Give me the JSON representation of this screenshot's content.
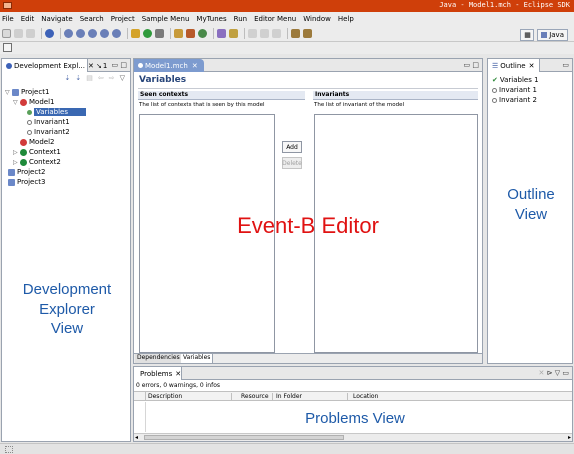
{
  "window": {
    "title": "Java - Model1.mch - Eclipse SDK"
  },
  "menu": [
    "File",
    "Edit",
    "Navigate",
    "Search",
    "Project",
    "Sample Menu",
    "MyTunes",
    "Run",
    "Editor Menu",
    "Window",
    "Help"
  ],
  "perspective": {
    "label": "Java"
  },
  "explorer": {
    "tab_label": "Development Expl...",
    "tab2_label": "1",
    "tree": [
      {
        "label": "Project1",
        "icon": "project",
        "depth": 0,
        "expanded": true
      },
      {
        "label": "Model1",
        "icon": "model",
        "depth": 1,
        "expanded": true
      },
      {
        "label": "Variables",
        "icon": "variable",
        "depth": 2,
        "selected": true
      },
      {
        "label": "Invariant1",
        "icon": "invariant",
        "depth": 2
      },
      {
        "label": "Invariant2",
        "icon": "invariant",
        "depth": 2
      },
      {
        "label": "Model2",
        "icon": "model",
        "depth": 1
      },
      {
        "label": "Context1",
        "icon": "context",
        "depth": 1,
        "collapsed": true
      },
      {
        "label": "Context2",
        "icon": "context",
        "depth": 1,
        "collapsed": true
      },
      {
        "label": "Project2",
        "icon": "project",
        "depth": 0
      },
      {
        "label": "Project3",
        "icon": "project",
        "depth": 0
      }
    ]
  },
  "editor": {
    "tab_label": "Model1.mch",
    "title": "Variables",
    "seen_header": "Seen contexts",
    "seen_desc": "The list of contexts that is seen by this model",
    "add_label": "Add",
    "delete_label": "Delete",
    "invariants_header": "Invariants",
    "invariants_desc": "The list of invariant of the model",
    "bottom_tabs": [
      "Dependencies",
      "Variables"
    ]
  },
  "outline": {
    "tab_label": "Outline",
    "items": [
      "Variables 1",
      "Invariant 1",
      "Invariant 2"
    ]
  },
  "problems": {
    "tab_label": "Problems",
    "summary": "0 errors, 0 warnings, 0 infos",
    "columns": [
      "Description",
      "Resource",
      "In Folder",
      "Location"
    ]
  },
  "overlays": {
    "editor": "Event-B Editor",
    "explorer": "Development\nExplorer\nView",
    "outline": "Outline\nView",
    "problems": "Problems View"
  },
  "colors": {
    "titlebar": "#cf3f0a",
    "overlay_red": "#e01212",
    "overlay_blue": "#1e5aa8",
    "selection": "#3a68b2"
  }
}
